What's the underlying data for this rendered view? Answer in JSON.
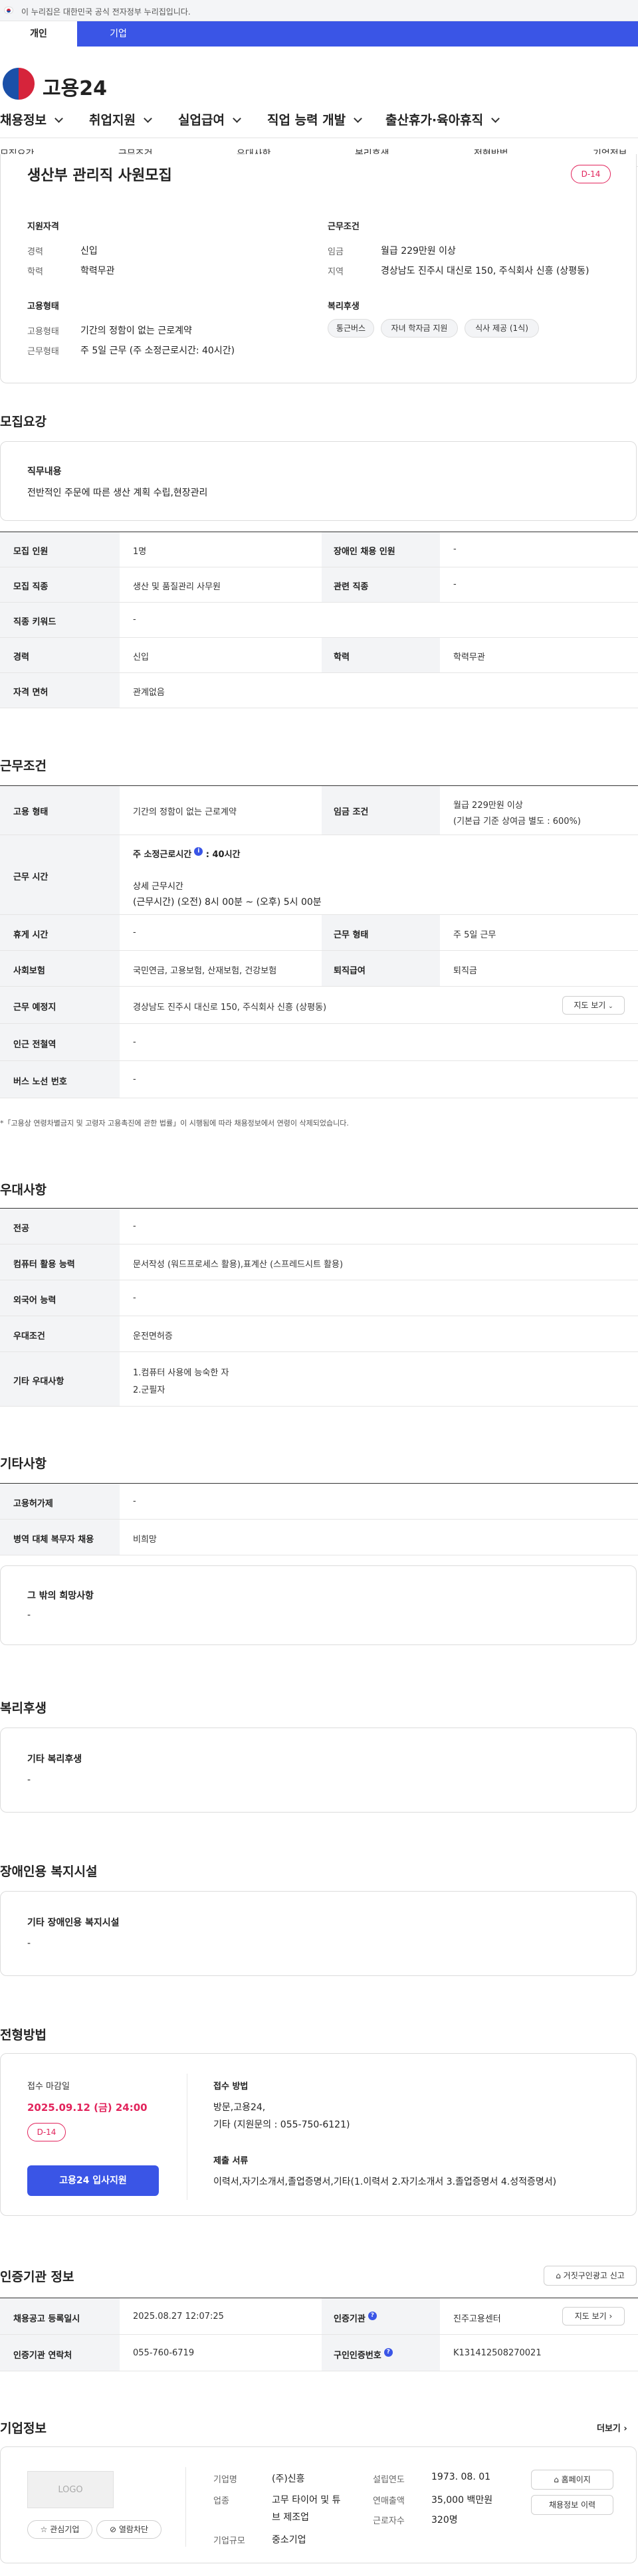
{
  "gov_banner": "이 누리집은 대한민국 공식 전자정부 누리집입니다.",
  "tabs": [
    "개인",
    "기업"
  ],
  "logo": "고용24",
  "gnb": [
    "채용정보",
    "취업지원",
    "실업급여",
    "직업 능력 개발",
    "출산휴가·육아휴직"
  ],
  "subnav": [
    "모집요강",
    "근무조건",
    "우대사항",
    "복리후생",
    "전형방법",
    "기업정보"
  ],
  "job": {
    "title": "생산부 관리직 사원모집",
    "dday": "D-14",
    "qual_title": "지원자격",
    "qual": [
      {
        "k": "경력",
        "v": "신입"
      },
      {
        "k": "학력",
        "v": "학력무관"
      }
    ],
    "cond_title": "근무조건",
    "cond": [
      {
        "k": "임금",
        "v": "월급 229만원 이상"
      },
      {
        "k": "지역",
        "v": "경상남도 진주시 대신로 150, 주식회사 신흥 (상평동)"
      }
    ],
    "emp_title": "고용형태",
    "emp": [
      {
        "k": "고용형태",
        "v": "기간의 정함이 없는 근로계약"
      },
      {
        "k": "근무형태",
        "v": "주 5일 근무 (주 소정근로시간: 40시간)"
      }
    ],
    "welfare_title": "복리후생",
    "welfare_chips": [
      "통근버스",
      "자녀 학자금 지원",
      "식사 제공 (1식)"
    ]
  },
  "recruit": {
    "title": "모집요강",
    "duty_title": "직무내용",
    "duty": "전반적인 주문에 따른 생산 계획 수립,현장관리",
    "rows": [
      {
        "h1": "모집 인원",
        "v1": "1명",
        "h2": "장애인 채용 인원",
        "v2": "-"
      },
      {
        "h1": "모집 직종",
        "v1": "생산 및 품질관리 사무원",
        "h2": "관련 직종",
        "v2": "-"
      },
      {
        "h1": "직종 키워드",
        "v1": "-"
      },
      {
        "h1": "경력",
        "v1": "신입",
        "h2": "학력",
        "v2": "학력무관"
      },
      {
        "h1": "자격 면허",
        "v1": "관계없음"
      }
    ]
  },
  "work": {
    "title": "근무조건",
    "type_h": "고용 형태",
    "type_v": "기간의 정함이 없는 근로계약",
    "wage_h": "임금 조건",
    "wage_v1": "월급 229만원 이상",
    "wage_v2": "(기본급 기준 상여금 별도 : 600%)",
    "hours_h": "근무 시간",
    "hours_l1": "주 소정근로시간",
    "hours_l1b": ": 40시간",
    "hours_l2": "상세 근무시간",
    "hours_l3": "(근무시간) (오전) 8시 00분 ~ (오후) 5시 00분",
    "rest_h": "휴게 시간",
    "rest_v": "-",
    "form_h": "근무 형태",
    "form_v": "주 5일 근무",
    "ins_h": "사회보험",
    "ins_v": "국민연금, 고용보험, 산재보험, 건강보험",
    "sev_h": "퇴직급여",
    "sev_v": "퇴직금",
    "place_h": "근무 예정지",
    "place_v": "경상남도 진주시 대신로 150, 주식회사 신흥 (상평동)",
    "map_btn": "지도 보기",
    "subway_h": "인근 전철역",
    "subway_v": "-",
    "bus_h": "버스 노선 번호",
    "bus_v": "-",
    "note": "*「고용상 연령차별금지 및 고령자 고용촉진에 관한 법률」이 시행됨에 따라 채용정보에서 연령이 삭제되었습니다."
  },
  "pref": {
    "title": "우대사항",
    "rows": [
      {
        "h": "전공",
        "v": "-"
      },
      {
        "h": "컴퓨터 활용 능력",
        "v": "문서작성 (워드프로세스 활용),표계산 (스프레드시트 활용)"
      },
      {
        "h": "외국어 능력",
        "v": "-"
      },
      {
        "h": "우대조건",
        "v": "운전면허증"
      },
      {
        "h": "기타 우대사항",
        "v": "1.컴퓨터 사용에 능숙한 자",
        "v2": "2.군필자"
      }
    ]
  },
  "etc": {
    "title": "기타사항",
    "rows": [
      {
        "h": "고용허가제",
        "v": "-"
      },
      {
        "h": "병역 대체 복무자 채용",
        "v": "비희망"
      }
    ],
    "other_title": "그 밖의 희망사항",
    "other_v": "-"
  },
  "benefit": {
    "title": "복리후생",
    "box_title": "기타 복리후생",
    "box_v": "-"
  },
  "disability": {
    "title": "장애인용 복지시설",
    "box_title": "기타 장애인용 복지시설",
    "box_v": "-"
  },
  "screen": {
    "title": "전형방법",
    "deadline_title": "접수 마감일",
    "deadline": "2025.09.12 (금) 24:00",
    "dday": "D-14",
    "apply_btn": "고용24 입사지원",
    "method_title": "접수 방법",
    "method_v1": "방문,고용24,",
    "method_v2": "기타 (지원문의 : 055-750-6121)",
    "docs_title": "제출 서류",
    "docs_v": "이력서,자기소개서,졸업증명서,기타(1.이력서 2.자기소개서 3.졸업증명서 4.성적증명서)"
  },
  "cert": {
    "title": "인증기관 정보",
    "report_btn": "거짓구인광고 신고",
    "r1_h1": "채용공고 등록일시",
    "r1_v1": "2025.08.27 12:07:25",
    "r1_h2": "인증기관",
    "r1_v2": "진주고용센터",
    "map_btn": "지도 보기",
    "r2_h1": "인증기관 연락처",
    "r2_v1": "055-760-6719",
    "r2_h2": "구인인증번호",
    "r2_v2": "K131412508270021"
  },
  "company": {
    "title": "기업정보",
    "more": "더보기",
    "logo": "LOGO",
    "fav_btn": "관심기업",
    "block_btn": "열람차단",
    "name_h": "기업명",
    "name_v": "(주)신흥",
    "ind_h": "업종",
    "ind_v1": "고무 타이어 및 튜",
    "ind_v2": "브 제조업",
    "size_h": "기업규모",
    "size_v": "중소기업",
    "est_h": "설립연도",
    "est_v": "1973. 08. 01",
    "sales_h": "연매출액",
    "sales_v": "35,000 백만원",
    "emp_h": "근로자수",
    "emp_v": "320명",
    "home_btn": "홈페이지",
    "history_btn": "채용정보 이력"
  },
  "colors": {
    "brand": "#3a55e6",
    "dday": "#e2245c"
  }
}
